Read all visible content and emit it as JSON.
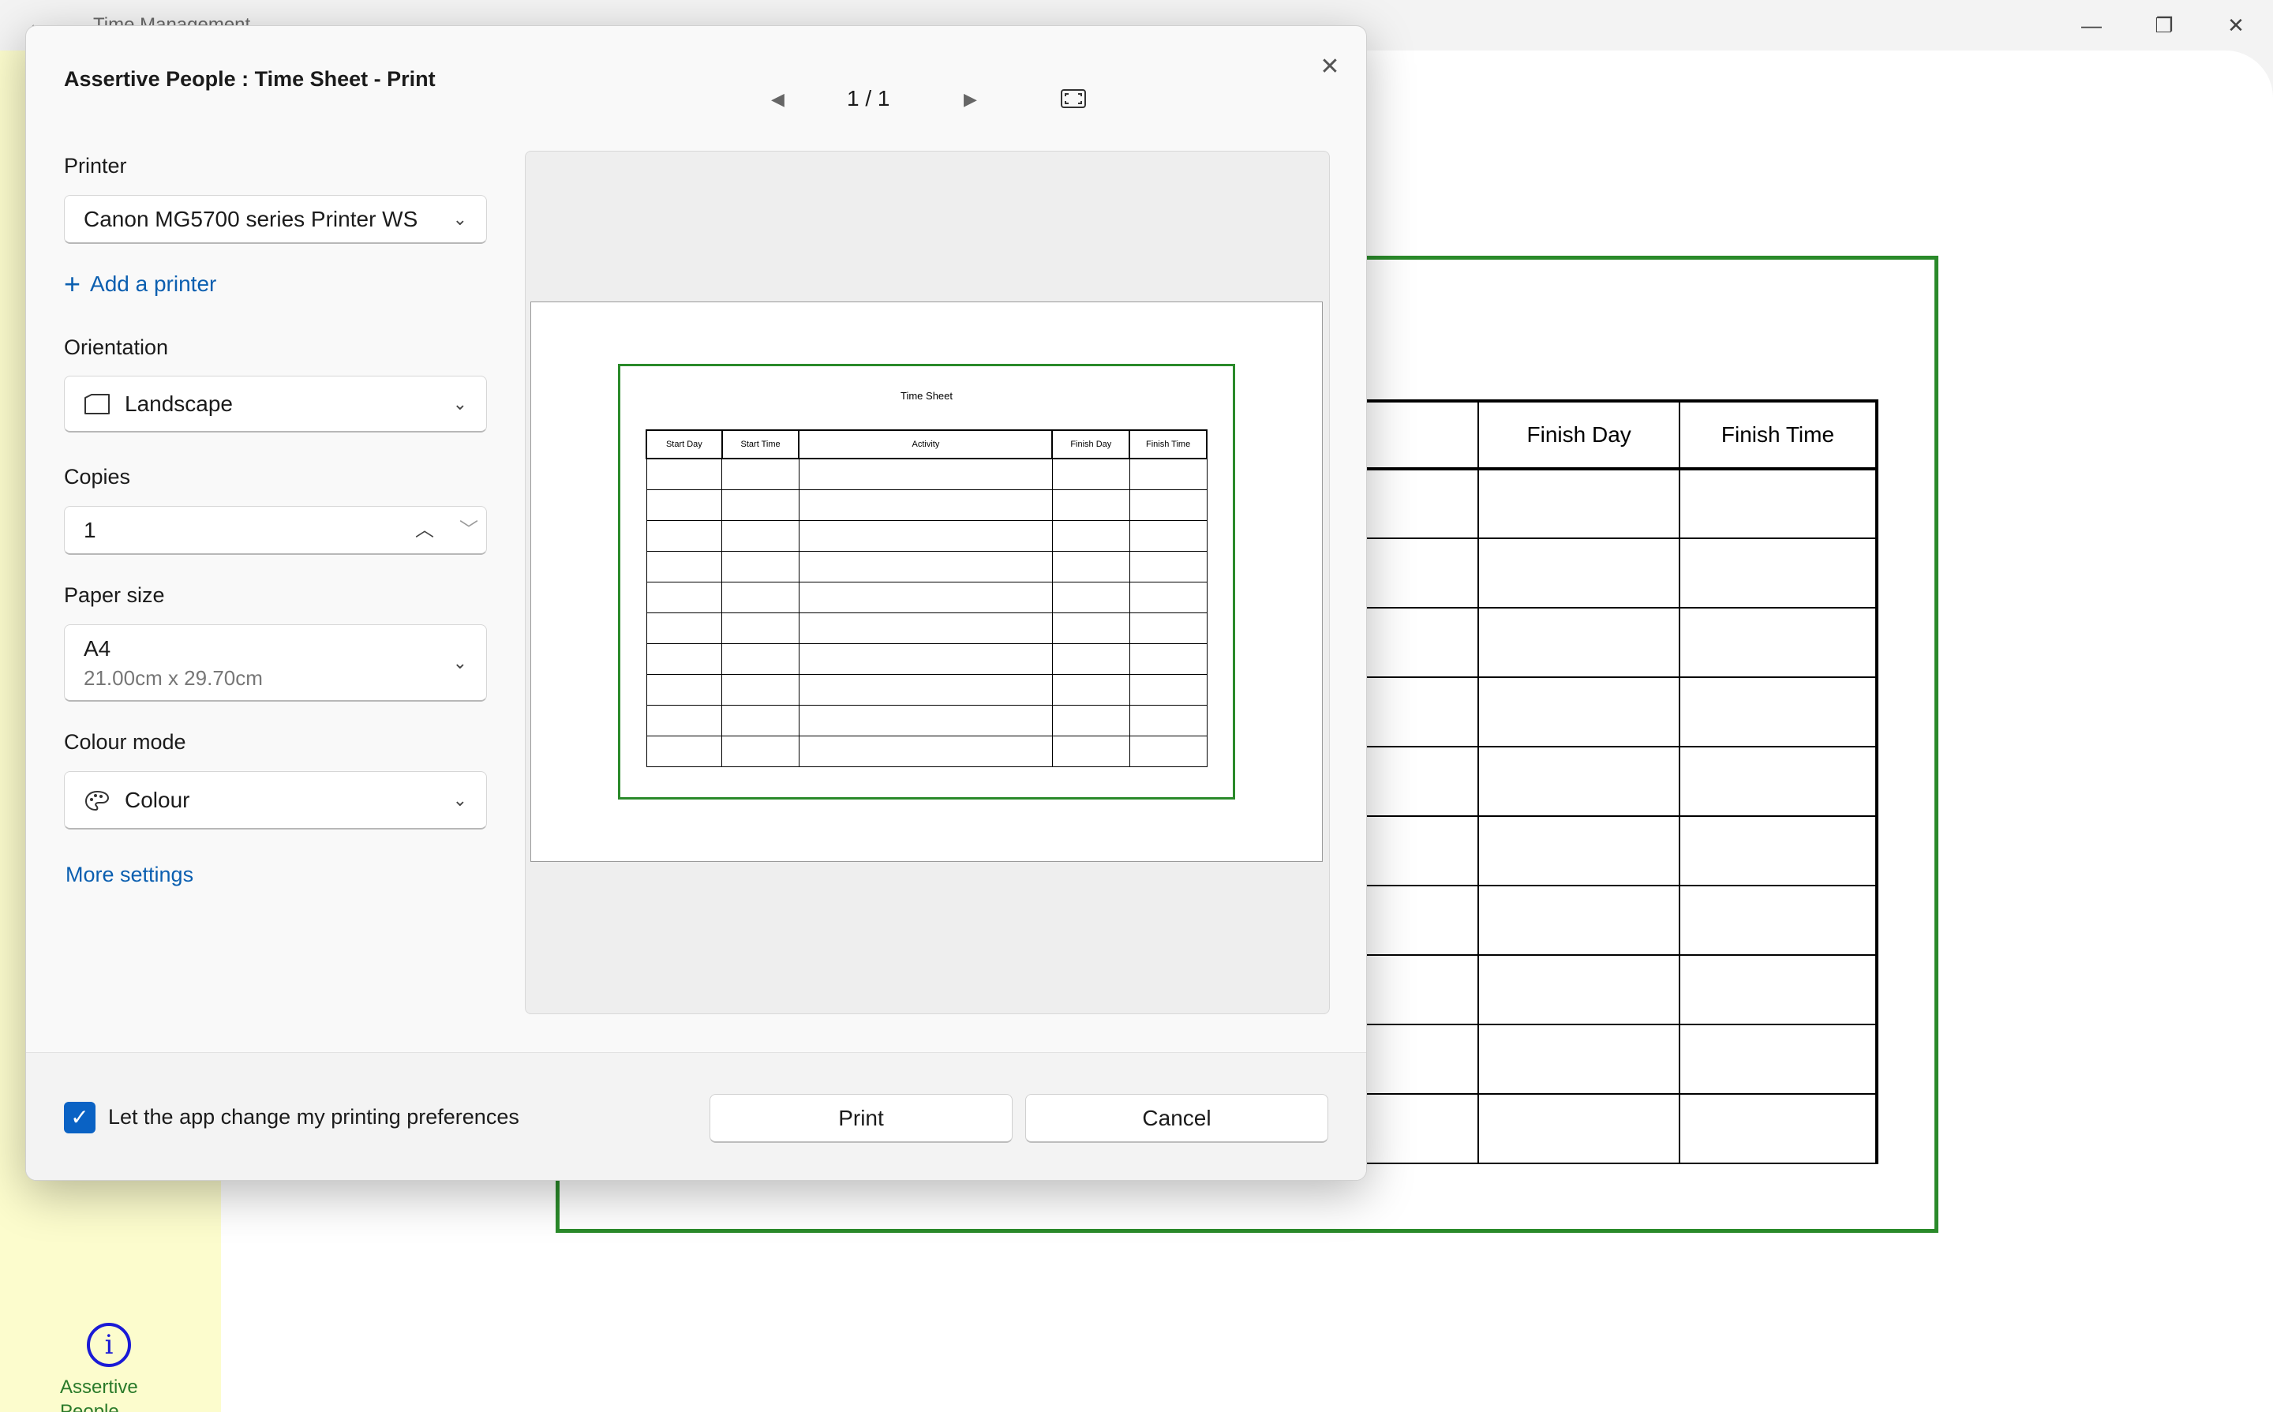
{
  "window": {
    "title": "Time Management",
    "back_icon": "←",
    "minimize_icon": "—",
    "maximize_icon": "❐",
    "close_icon": "✕"
  },
  "sidebar": {
    "info_icon": "i",
    "info_label": "Assertive People Information",
    "accent_color": "#fcfccd"
  },
  "sheet": {
    "headers": [
      "Finish Day",
      "Finish Time"
    ],
    "frame_color": "#2a8a2a"
  },
  "dialog": {
    "title": "Assertive People : Time Sheet - Print",
    "close_icon": "✕",
    "printer": {
      "label": "Printer",
      "value": "Canon MG5700 series Printer WS",
      "add_label": "Add a printer",
      "add_icon": "+"
    },
    "orientation": {
      "label": "Orientation",
      "value": "Landscape"
    },
    "copies": {
      "label": "Copies",
      "value": "1",
      "up_icon": "︿",
      "down_icon": "﹀"
    },
    "paper_size": {
      "label": "Paper size",
      "value": "A4",
      "detail": "21.00cm x 29.70cm"
    },
    "colour_mode": {
      "label": "Colour mode",
      "value": "Colour"
    },
    "more_settings": "More settings",
    "chevron_icon": "⌄",
    "preview": {
      "prev_icon": "◀",
      "next_icon": "▶",
      "page_indicator": "1 / 1",
      "doc_title": "Time Sheet",
      "columns": [
        "Start Day",
        "Start Time",
        "Activity",
        "Finish Day",
        "Finish Time"
      ]
    },
    "footer": {
      "checkbox_label": "Let the app change my printing preferences",
      "checkbox_checked": true,
      "check_icon": "✓",
      "print_label": "Print",
      "cancel_label": "Cancel"
    },
    "accent_color": "#0a62c4",
    "link_color": "#0b5fb0"
  }
}
